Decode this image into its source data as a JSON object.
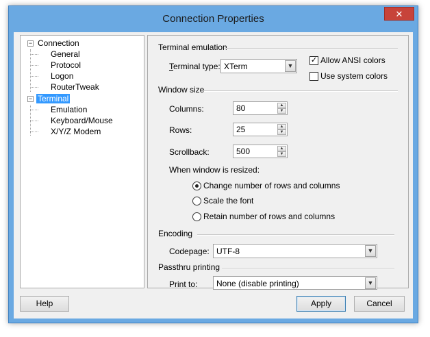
{
  "window": {
    "title": "Connection Properties",
    "close_glyph": "✕"
  },
  "tree": {
    "items": [
      {
        "label": "Connection",
        "toggle": "−"
      },
      {
        "label": "General"
      },
      {
        "label": "Protocol"
      },
      {
        "label": "Logon"
      },
      {
        "label": "RouterTweak"
      },
      {
        "label": "Terminal",
        "toggle": "−",
        "selected": true
      },
      {
        "label": "Emulation"
      },
      {
        "label": "Keyboard/Mouse"
      },
      {
        "label": "X/Y/Z Modem"
      }
    ]
  },
  "terminal_emulation": {
    "heading": "Terminal emulation",
    "terminal_type_label": "Terminal type:",
    "terminal_type_value": "XTerm",
    "allow_ansi_label": "Allow ANSI colors",
    "allow_ansi_checked": true,
    "allow_ansi_mark": "✓",
    "use_system_colors_label": "Use system colors",
    "use_system_colors_checked": false
  },
  "window_size": {
    "heading": "Window size",
    "columns_label": "Columns:",
    "columns_value": "80",
    "rows_label": "Rows:",
    "rows_value": "25",
    "scrollback_label": "Scrollback:",
    "scrollback_value": "500",
    "resize_label": "When window is resized:",
    "resize_options": [
      {
        "label": "Change number of rows and columns",
        "selected": true
      },
      {
        "label": "Scale the font",
        "selected": false
      },
      {
        "label": "Retain number of rows and columns",
        "selected": false
      }
    ]
  },
  "encoding": {
    "heading": "Encoding",
    "codepage_label": "Codepage:",
    "codepage_value": "UTF-8"
  },
  "passthru": {
    "heading": "Passthru printing",
    "print_to_label": "Print to:",
    "print_to_value": "None (disable printing)"
  },
  "icons": {
    "dropdown_arrow": "▼",
    "spin_up": "▲",
    "spin_down": "▼"
  },
  "buttons": {
    "help": "Help",
    "apply": "Apply",
    "cancel": "Cancel"
  },
  "colors": {
    "title_bar": "#6aa9e2",
    "selection": "#3399ff",
    "close": "#c7433a"
  }
}
